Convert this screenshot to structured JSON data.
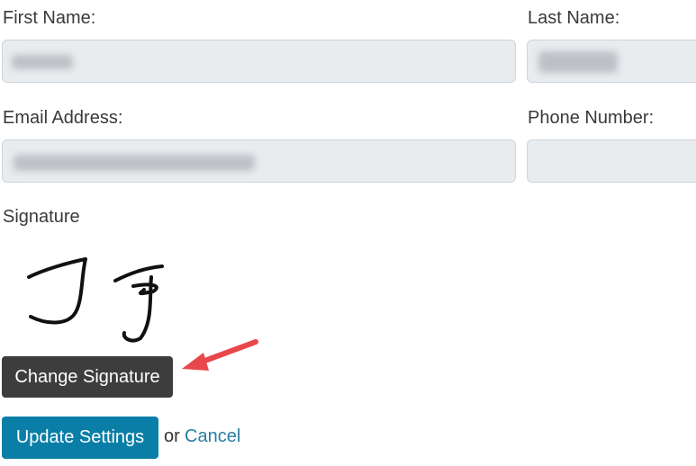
{
  "form": {
    "first_name_label": "First Name:",
    "last_name_label": "Last Name:",
    "email_label": "Email Address:",
    "phone_label": "Phone Number:",
    "signature_label": "Signature",
    "first_name_value": "",
    "last_name_value": "",
    "email_value": "",
    "phone_value": ""
  },
  "signature": {
    "initials": "J J"
  },
  "buttons": {
    "change_signature": "Change Signature",
    "update_settings": "Update Settings",
    "or_text": "or",
    "cancel": "Cancel"
  },
  "colors": {
    "annotation_arrow": "#e8474c",
    "primary_button": "#0a7ea7",
    "dark_button": "#3d3d3d",
    "link": "#2a7ea1",
    "input_bg": "#e9ecef"
  },
  "annotation": {
    "icon": "red-arrow-icon"
  }
}
